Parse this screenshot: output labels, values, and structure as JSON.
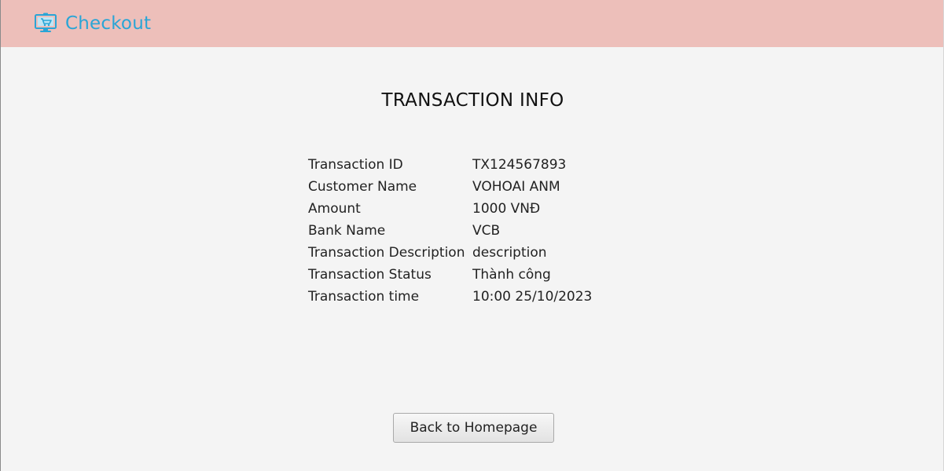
{
  "header": {
    "icon": "monitor-cart-icon",
    "title": "Checkout",
    "background_color": "#edbfba",
    "title_color": "#2aa5d6"
  },
  "main": {
    "title": "TRANSACTION INFO",
    "rows": [
      {
        "label": "Transaction ID",
        "value": "TX124567893"
      },
      {
        "label": "Customer Name",
        "value": "VOHOAI ANM"
      },
      {
        "label": "Amount",
        "value": "1000 VNĐ"
      },
      {
        "label": "Bank Name",
        "value": "VCB"
      },
      {
        "label": "Transaction Description",
        "value": "description"
      },
      {
        "label": "Transaction Status",
        "value": "Thành công"
      },
      {
        "label": "Transaction time",
        "value": "10:00 25/10/2023"
      }
    ],
    "back_button_label": "Back to Homepage"
  }
}
